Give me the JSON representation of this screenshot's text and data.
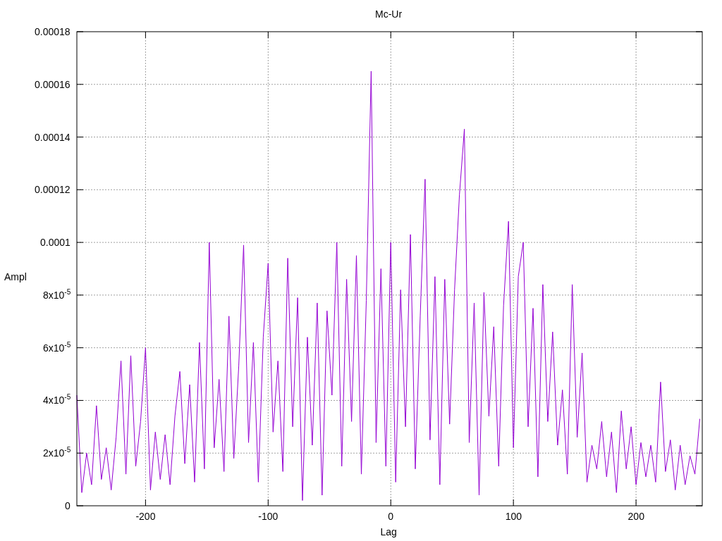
{
  "chart": {
    "chart_data": {
      "type": "line",
      "title": "Mc-Ur",
      "xlabel": "Lag",
      "ylabel": "Ampl",
      "grid": true,
      "xlim": [
        -256,
        254
      ],
      "ylim": [
        0,
        0.00018
      ],
      "xticks": [
        {
          "value": -200,
          "label": "-200"
        },
        {
          "value": -100,
          "label": "-100"
        },
        {
          "value": 0,
          "label": "0"
        },
        {
          "value": 100,
          "label": "100"
        },
        {
          "value": 200,
          "label": "200"
        }
      ],
      "yticks": [
        {
          "value": 0,
          "label": "0"
        },
        {
          "value": 2e-05,
          "label": "2x10$^{-5}$"
        },
        {
          "value": 4e-05,
          "label": "4x10$^{-5}$"
        },
        {
          "value": 6e-05,
          "label": "6x10$^{-5}$"
        },
        {
          "value": 8e-05,
          "label": "8x10$^{-5}$"
        },
        {
          "value": 0.0001,
          "label": "0.0001"
        },
        {
          "value": 0.00012,
          "label": "0.00012"
        },
        {
          "value": 0.00014,
          "label": "0.00014"
        },
        {
          "value": 0.00016,
          "label": "0.00016"
        },
        {
          "value": 0.00018,
          "label": "0.00018"
        }
      ],
      "x": [
        -256,
        -252,
        -248,
        -244,
        -240,
        -236,
        -232,
        -228,
        -224,
        -220,
        -216,
        -212,
        -208,
        -204,
        -200,
        -196,
        -192,
        -188,
        -184,
        -180,
        -176,
        -172,
        -168,
        -164,
        -160,
        -156,
        -152,
        -148,
        -144,
        -140,
        -136,
        -132,
        -128,
        -124,
        -120,
        -116,
        -112,
        -108,
        -104,
        -100,
        -96,
        -92,
        -88,
        -84,
        -80,
        -76,
        -72,
        -68,
        -64,
        -60,
        -56,
        -52,
        -48,
        -44,
        -40,
        -36,
        -32,
        -28,
        -24,
        -20,
        -16,
        -12,
        -8,
        -4,
        0,
        4,
        8,
        12,
        16,
        20,
        24,
        28,
        32,
        36,
        40,
        44,
        48,
        52,
        56,
        60,
        64,
        68,
        72,
        76,
        80,
        84,
        88,
        92,
        96,
        100,
        104,
        108,
        112,
        116,
        120,
        124,
        128,
        132,
        136,
        140,
        144,
        148,
        152,
        156,
        160,
        164,
        168,
        172,
        176,
        180,
        184,
        188,
        192,
        196,
        200,
        204,
        208,
        212,
        216,
        220,
        224,
        228,
        232,
        236,
        240,
        244,
        248,
        252
      ],
      "series": [
        {
          "color": "#9400d3",
          "values": [
            4.2e-05,
            5e-06,
            2e-05,
            8e-06,
            3.8e-05,
            1e-05,
            2.2e-05,
            6e-06,
            2.6e-05,
            5.5e-05,
            1.2e-05,
            5.7e-05,
            1.5e-05,
            3.2e-05,
            6e-05,
            6e-06,
            2.8e-05,
            1e-05,
            2.7e-05,
            8e-06,
            3.4e-05,
            5.1e-05,
            1.6e-05,
            4.6e-05,
            9e-06,
            6.2e-05,
            1.4e-05,
            0.0001,
            2.2e-05,
            4.8e-05,
            1.3e-05,
            7.2e-05,
            1.8e-05,
            5.3e-05,
            9.9e-05,
            2.4e-05,
            6.2e-05,
            9e-06,
            6.4e-05,
            9.2e-05,
            2.8e-05,
            5.5e-05,
            1.3e-05,
            9.4e-05,
            3e-05,
            7.9e-05,
            2e-06,
            6.4e-05,
            2.3e-05,
            7.7e-05,
            4e-06,
            7.4e-05,
            4.2e-05,
            0.0001,
            1.5e-05,
            8.6e-05,
            3.2e-05,
            9.5e-05,
            1.2e-05,
            7.8e-05,
            0.000165,
            2.4e-05,
            9e-05,
            1.5e-05,
            0.0001,
            9e-06,
            8.2e-05,
            3e-05,
            0.000103,
            1.4e-05,
            7.2e-05,
            0.000124,
            2.5e-05,
            8.7e-05,
            8e-06,
            8.6e-05,
            3.1e-05,
            8.2e-05,
            0.000118,
            0.000143,
            2.4e-05,
            7.7e-05,
            4e-06,
            8.1e-05,
            3.4e-05,
            6.8e-05,
            1.5e-05,
            7.6e-05,
            0.000108,
            2.2e-05,
            8.7e-05,
            0.0001,
            3e-05,
            7.5e-05,
            1.1e-05,
            8.4e-05,
            3.2e-05,
            6.6e-05,
            2.3e-05,
            4.4e-05,
            1.2e-05,
            8.4e-05,
            2.6e-05,
            5.8e-05,
            9e-06,
            2.3e-05,
            1.4e-05,
            3.2e-05,
            1.1e-05,
            2.8e-05,
            5e-06,
            3.6e-05,
            1.4e-05,
            3e-05,
            8e-06,
            2.4e-05,
            1.1e-05,
            2.3e-05,
            9e-06,
            4.7e-05,
            1.3e-05,
            2.5e-05,
            6e-06,
            2.3e-05,
            8e-06,
            1.9e-05,
            1.2e-05,
            3.3e-05
          ]
        }
      ]
    }
  }
}
